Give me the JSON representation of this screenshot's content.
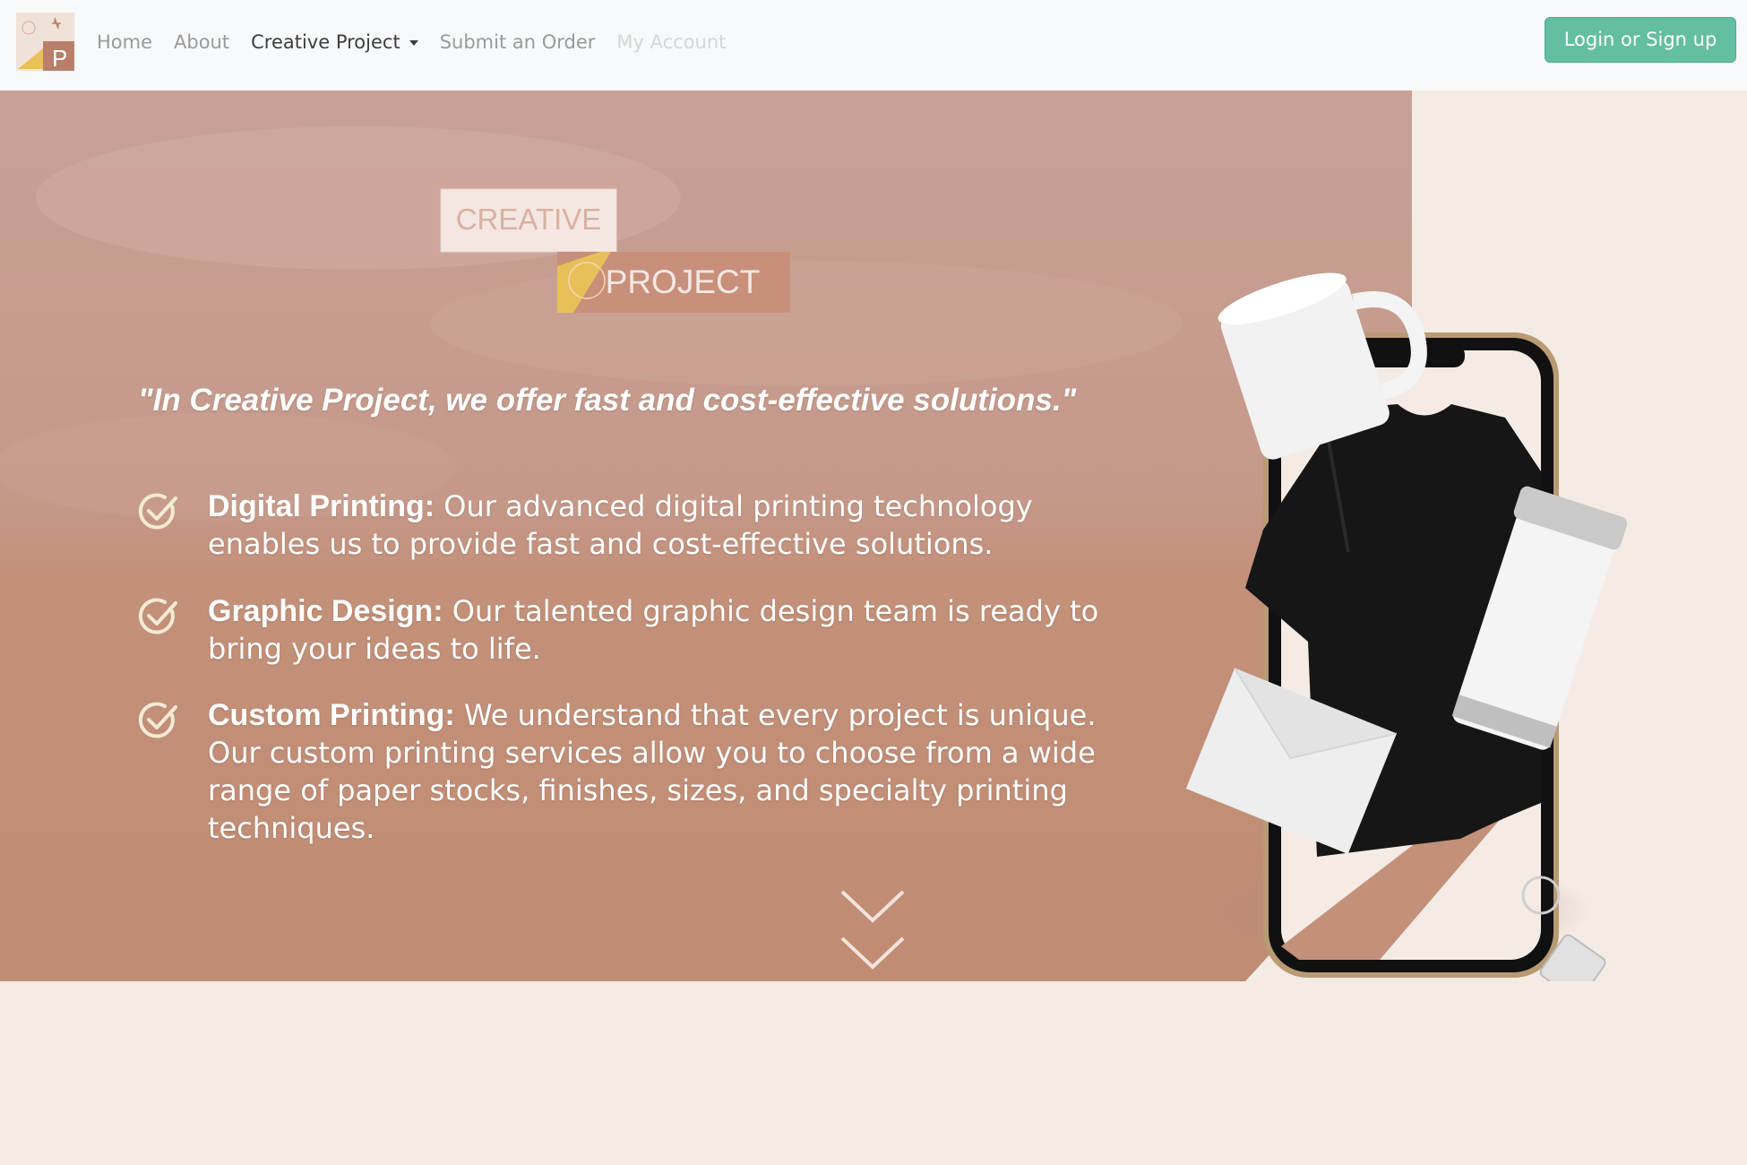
{
  "nav": {
    "links": [
      {
        "label": "Home"
      },
      {
        "label": "About"
      },
      {
        "label": "Creative Project"
      },
      {
        "label": "Submit an Order"
      },
      {
        "label": "My Account"
      }
    ],
    "login_label": "Login or Sign up"
  },
  "hero": {
    "logo": {
      "word1": "CREATIVE",
      "word2": "PROJECT"
    },
    "tagline": "\"In Creative Project, we offer fast and cost-effective solutions.\"",
    "features": [
      {
        "title": "Digital Printing:",
        "body": " Our advanced digital printing technology enables us to provide fast and cost-effective solutions."
      },
      {
        "title": "Graphic Design:",
        "body": " Our talented graphic design team is ready to bring your ideas to life."
      },
      {
        "title": "Custom Printing:",
        "body": " We understand that every project is unique. Our custom printing services allow you to choose from a wide range of paper stocks, finishes, sizes, and specialty printing techniques."
      }
    ]
  },
  "colors": {
    "accent": "#63bfa0",
    "hero_terracotta": "#c39079",
    "page_background": "#f5ebe5",
    "nav_background": "#f8f9fb"
  },
  "icons": [
    "logo-icon",
    "check-icon",
    "chevron-down-icon"
  ]
}
